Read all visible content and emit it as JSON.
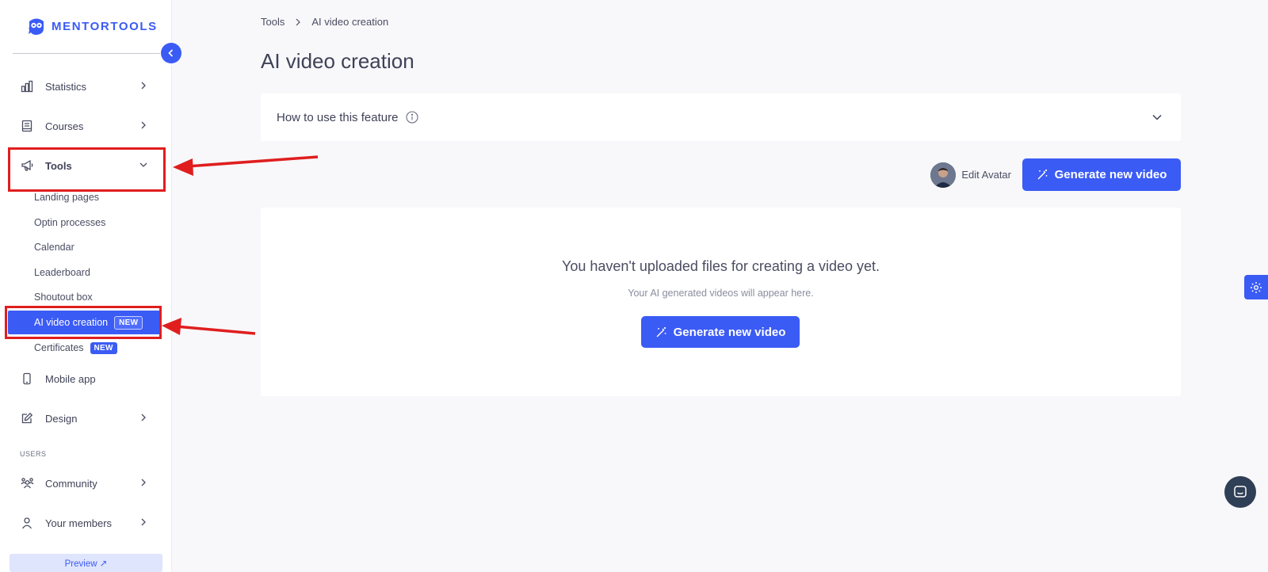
{
  "brand": {
    "name": "MENTORTOOLS",
    "accent": "#3b5bf5"
  },
  "sidebar": {
    "items": [
      {
        "label": "Statistics",
        "icon": "bar-chart-icon"
      },
      {
        "label": "Courses",
        "icon": "book-icon"
      },
      {
        "label": "Tools",
        "icon": "megaphone-icon",
        "expanded": true
      },
      {
        "label": "Mobile app",
        "icon": "phone-icon"
      },
      {
        "label": "Design",
        "icon": "pencil-icon"
      }
    ],
    "tools_submenu": [
      {
        "label": "Landing pages"
      },
      {
        "label": "Optin processes"
      },
      {
        "label": "Calendar"
      },
      {
        "label": "Leaderboard"
      },
      {
        "label": "Shoutout box"
      },
      {
        "label": "AI video creation",
        "badge": "NEW",
        "active": true
      },
      {
        "label": "Certificates",
        "badge": "NEW"
      }
    ],
    "users_section": {
      "label": "USERS",
      "items": [
        {
          "label": "Community",
          "icon": "people-icon"
        },
        {
          "label": "Your members",
          "icon": "user-icon"
        }
      ]
    },
    "preview_label": "Preview ↗"
  },
  "breadcrumb": {
    "items": [
      "Tools",
      "AI video creation"
    ]
  },
  "page": {
    "title": "AI video creation",
    "howto_label": "How to use this feature",
    "edit_avatar_label": "Edit Avatar",
    "generate_label": "Generate new video",
    "empty_title": "You haven't uploaded files for creating a video yet.",
    "empty_subtitle": "Your AI generated videos will appear here.",
    "empty_button_label": "Generate new video"
  },
  "colors": {
    "annotation": "#e01e1e"
  }
}
